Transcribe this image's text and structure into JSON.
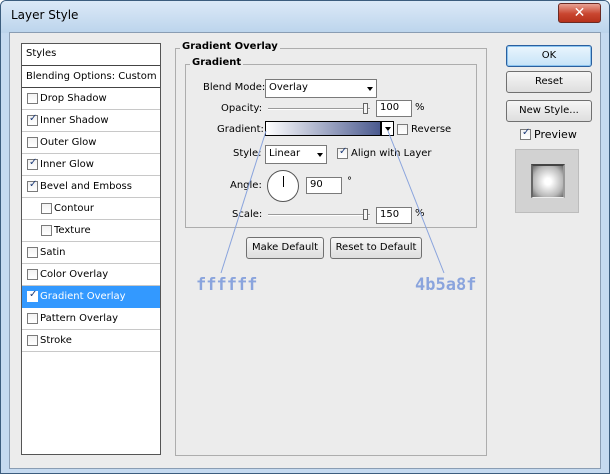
{
  "window": {
    "title": "Layer Style",
    "close_glyph": "✕"
  },
  "styles_panel": {
    "header": "Styles",
    "blending": "Blending Options: Custom",
    "items": [
      {
        "label": "Drop Shadow",
        "checked": false
      },
      {
        "label": "Inner Shadow",
        "checked": true
      },
      {
        "label": "Outer Glow",
        "checked": false
      },
      {
        "label": "Inner Glow",
        "checked": true
      },
      {
        "label": "Bevel and Emboss",
        "checked": true
      },
      {
        "label": "Contour",
        "checked": false,
        "sub": true
      },
      {
        "label": "Texture",
        "checked": false,
        "sub": true
      },
      {
        "label": "Satin",
        "checked": false
      },
      {
        "label": "Color Overlay",
        "checked": false
      },
      {
        "label": "Gradient Overlay",
        "checked": true,
        "selected": true
      },
      {
        "label": "Pattern Overlay",
        "checked": false
      },
      {
        "label": "Stroke",
        "checked": false
      }
    ]
  },
  "gradient_overlay": {
    "section_title": "Gradient Overlay",
    "group_title": "Gradient",
    "blend_mode_label": "Blend Mode:",
    "blend_mode_value": "Overlay",
    "opacity_label": "Opacity:",
    "opacity_value": "100",
    "opacity_unit": "%",
    "opacity_level": 1.0,
    "gradient_label": "Gradient:",
    "gradient_start": "#ffffff",
    "gradient_end": "#4b5a8f",
    "reverse_label": "Reverse",
    "reverse_checked": false,
    "style_label": "Style:",
    "style_value": "Linear",
    "align_label": "Align with Layer",
    "align_checked": true,
    "angle_label": "Angle:",
    "angle_value": "90",
    "angle_unit": "°",
    "scale_label": "Scale:",
    "scale_value": "150",
    "scale_unit": "%",
    "make_default": "Make Default",
    "reset_default": "Reset to Default"
  },
  "annotations": {
    "left_color": "ffffff",
    "right_color": "4b5a8f",
    "color": "#8aa4dd"
  },
  "buttons": {
    "ok": "OK",
    "reset": "Reset",
    "new_style": "New Style...",
    "preview": "Preview",
    "preview_checked": true
  },
  "colors": {
    "selection": "#3399ff",
    "window_frame": "#c5daf0",
    "close_button": "#c9452f"
  }
}
